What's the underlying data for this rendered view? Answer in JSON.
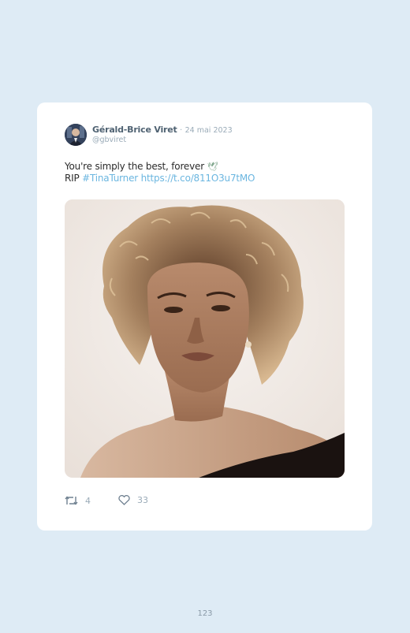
{
  "tweet": {
    "author_name": "Géra​ld-Brice Viret",
    "separator": "·",
    "date": "24 mai 2023",
    "handle": "@gbviret",
    "text_line1": "You're simply the best, forever",
    "dove_emoji": "🕊",
    "text_line2_prefix": "RIP ",
    "hashtag": "#TinaTurner",
    "link": "https://t.co/811O3u7tMO",
    "image_alt": "Black and white portrait of Tina Turner with voluminous curly hair",
    "retweet_icon": "retweet-icon",
    "retweet_count": "4",
    "like_icon": "heart-icon",
    "like_count": "33",
    "colors": {
      "link": "#6bb6e0",
      "name": "#4f6272",
      "muted": "#9aabb8",
      "background": "#deebf5"
    }
  },
  "page": {
    "number": "123"
  }
}
